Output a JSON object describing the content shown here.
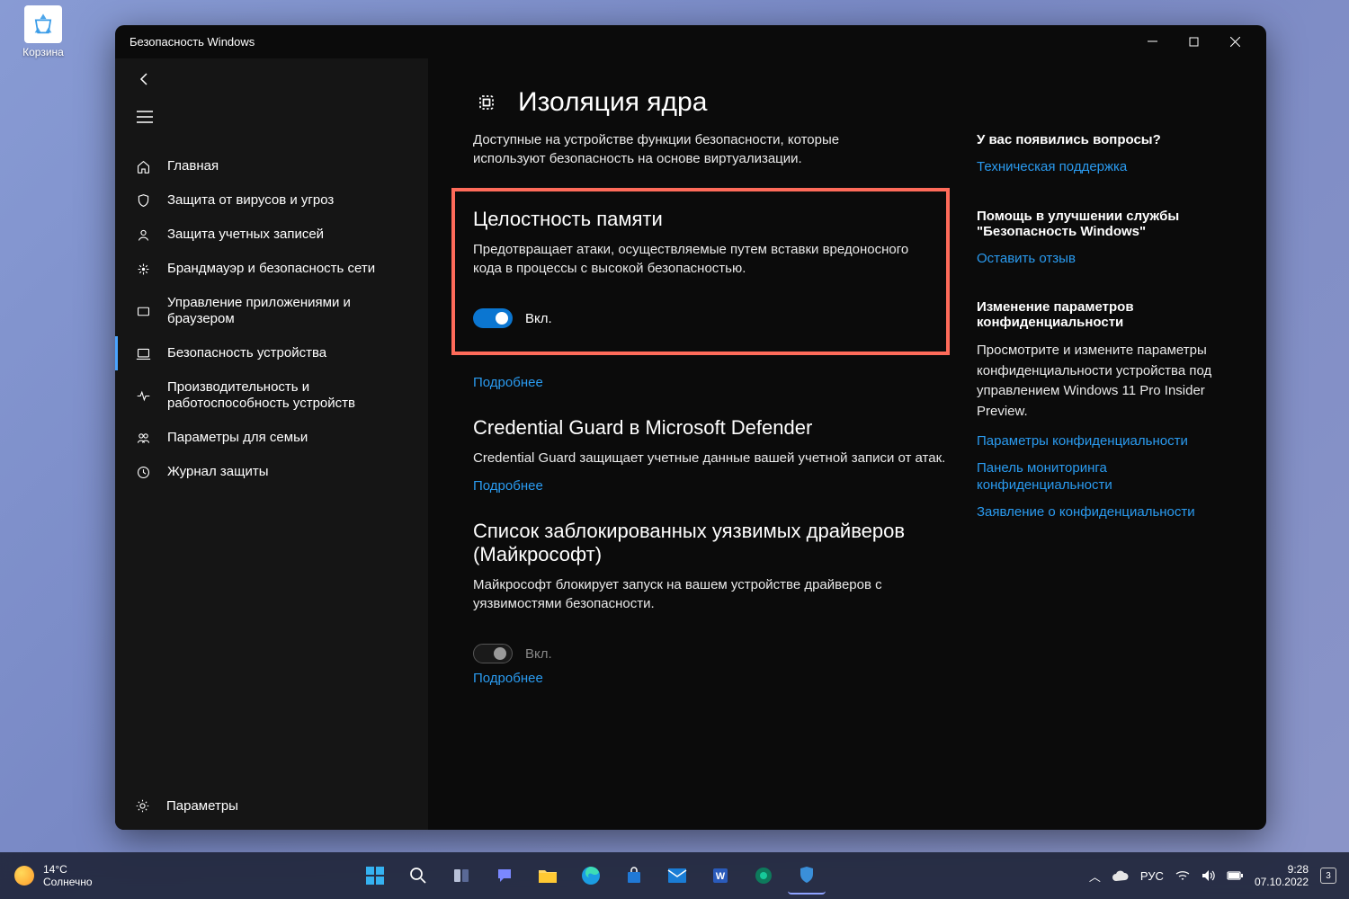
{
  "desktop": {
    "recycle_bin": "Корзина"
  },
  "window": {
    "title": "Безопасность Windows"
  },
  "sidebar": {
    "items": [
      {
        "label": "Главная"
      },
      {
        "label": "Защита от вирусов и угроз"
      },
      {
        "label": "Защита учетных записей"
      },
      {
        "label": "Брандмауэр и безопасность сети"
      },
      {
        "label": "Управление приложениями и браузером"
      },
      {
        "label": "Безопасность устройства"
      },
      {
        "label": "Производительность и работоспособность устройств"
      },
      {
        "label": "Параметры для семьи"
      },
      {
        "label": "Журнал защиты"
      }
    ],
    "bottom": "Параметры"
  },
  "page": {
    "title": "Изоляция ядра",
    "desc": "Доступные на устройстве функции безопасности, которые используют безопасность на основе виртуализации."
  },
  "sections": {
    "mem": {
      "title": "Целостность памяти",
      "desc": "Предотвращает атаки, осуществляемые путем вставки вредоносного кода в процессы с высокой безопасностью.",
      "toggle_label": "Вкл.",
      "more": "Подробнее"
    },
    "credguard": {
      "title": "Credential Guard в Microsoft Defender",
      "desc": "Credential Guard защищает учетные данные вашей учетной записи от атак.",
      "more": "Подробнее"
    },
    "drivers": {
      "title": "Список заблокированных уязвимых драйверов (Майкрософт)",
      "desc": "Майкрософт блокирует запуск на вашем устройстве драйверов с уязвимостями безопасности.",
      "toggle_label": "Вкл.",
      "more": "Подробнее"
    }
  },
  "side": {
    "questions": {
      "heading": "У вас появились вопросы?",
      "link": "Техническая поддержка"
    },
    "feedback": {
      "heading": "Помощь в улучшении службы \"Безопасность Windows\"",
      "link": "Оставить отзыв"
    },
    "privacy": {
      "heading": "Изменение параметров конфиденциальности",
      "text": "Просмотрите и измените параметры конфиденциальности устройства под управлением Windows 11 Pro Insider Preview.",
      "links": [
        "Параметры конфиденциальности",
        "Панель мониторинга конфиденциальности",
        "Заявление о конфиденциальности"
      ]
    }
  },
  "taskbar": {
    "temp": "14°C",
    "weather": "Солнечно",
    "lang": "РУС",
    "time": "9:28",
    "date": "07.10.2022",
    "notif": "3"
  }
}
